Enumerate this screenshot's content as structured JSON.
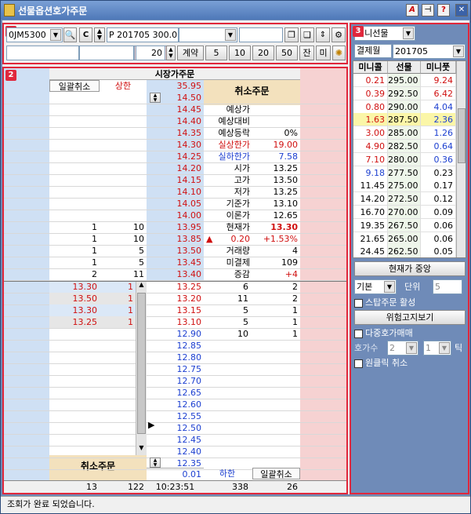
{
  "window": {
    "title": "선물옵션호가주문"
  },
  "toolbar": {
    "account": "0JM5300",
    "symbol": "P 201705 300.0",
    "qty": "20",
    "contract_label": "계약",
    "qty_presets": [
      "5",
      "10",
      "20",
      "50"
    ],
    "jan_label": "잔",
    "mi_label": "미"
  },
  "ladder": {
    "header": "시장가주문",
    "top_left_button": "일괄취소",
    "upper_limit_label": "상한",
    "upper_limit_price": "35.95",
    "sell_cancel": "취소주문",
    "buy_cancel": "취소주문",
    "bottom_lower_label": "하한",
    "bottom_lower_price": "0.01",
    "bottom_cancel_all": "일괄취소",
    "ask_rows": [
      {
        "price": "14.50",
        "qty": "",
        "cnt": ""
      },
      {
        "price": "14.45",
        "qty": "",
        "cnt": ""
      },
      {
        "price": "14.40",
        "qty": "",
        "cnt": ""
      },
      {
        "price": "14.35",
        "qty": "",
        "cnt": ""
      },
      {
        "price": "14.30",
        "qty": "",
        "cnt": ""
      },
      {
        "price": "14.25",
        "qty": "",
        "cnt": ""
      },
      {
        "price": "14.20",
        "qty": "",
        "cnt": ""
      },
      {
        "price": "14.15",
        "qty": "",
        "cnt": ""
      },
      {
        "price": "14.10",
        "qty": "",
        "cnt": ""
      },
      {
        "price": "14.05",
        "qty": "",
        "cnt": ""
      },
      {
        "price": "14.00",
        "qty": "",
        "cnt": ""
      },
      {
        "price": "13.95",
        "qty": "1",
        "cnt": "10"
      },
      {
        "price": "13.85",
        "qty": "1",
        "cnt": "10"
      },
      {
        "price": "13.50",
        "qty": "1",
        "cnt": "5"
      },
      {
        "price": "13.45",
        "qty": "1",
        "cnt": "5"
      },
      {
        "price": "13.40",
        "qty": "2",
        "cnt": "11"
      }
    ],
    "bid_rows": [
      {
        "price": "13.25",
        "qty": "6",
        "cnt": "2"
      },
      {
        "price": "13.20",
        "qty": "11",
        "cnt": "2"
      },
      {
        "price": "13.15",
        "qty": "5",
        "cnt": "1"
      },
      {
        "price": "13.10",
        "qty": "5",
        "cnt": "1"
      },
      {
        "price": "12.90",
        "qty": "10",
        "cnt": "1"
      },
      {
        "price": "12.85",
        "qty": "",
        "cnt": ""
      },
      {
        "price": "12.80",
        "qty": "",
        "cnt": ""
      },
      {
        "price": "12.75",
        "qty": "",
        "cnt": ""
      },
      {
        "price": "12.70",
        "qty": "",
        "cnt": ""
      },
      {
        "price": "12.65",
        "qty": "",
        "cnt": ""
      },
      {
        "price": "12.60",
        "qty": "",
        "cnt": ""
      },
      {
        "price": "12.55",
        "qty": "",
        "cnt": ""
      },
      {
        "price": "12.50",
        "qty": "",
        "cnt": ""
      },
      {
        "price": "12.45",
        "qty": "",
        "cnt": ""
      },
      {
        "price": "12.40",
        "qty": "",
        "cnt": ""
      },
      {
        "price": "12.35",
        "qty": "",
        "cnt": ""
      }
    ],
    "pending_orders": [
      {
        "price": "13.30",
        "qty": "1"
      },
      {
        "price": "13.50",
        "qty": "1"
      },
      {
        "price": "13.30",
        "qty": "1"
      },
      {
        "price": "13.25",
        "qty": "1"
      }
    ],
    "info": [
      {
        "label": "예상가",
        "value": ""
      },
      {
        "label": "예상대비",
        "value": ""
      },
      {
        "label": "예상등락",
        "value": "0%"
      },
      {
        "label": "실상한가",
        "value": "19.00"
      },
      {
        "label": "실하한가",
        "value": "7.58"
      },
      {
        "label": "시가",
        "value": "13.25"
      },
      {
        "label": "고가",
        "value": "13.50"
      },
      {
        "label": "저가",
        "value": "13.25"
      },
      {
        "label": "기준가",
        "value": "13.10"
      },
      {
        "label": "이론가",
        "value": "12.65"
      },
      {
        "label": "현재가",
        "value": "13.30"
      }
    ],
    "change_arrow": "▲",
    "change_value": "0.20",
    "change_pct": "+1.53%",
    "volume_label": "거래량",
    "volume": "4",
    "open_interest_label": "미결제",
    "open_interest": "109",
    "oi_change_label": "증감",
    "oi_change": "+4",
    "footer": {
      "ask_total_qty": "13",
      "ask_total_cnt": "122",
      "time": "10:23:51",
      "bid_total_qty": "338",
      "bid_total_cnt": "26"
    }
  },
  "right": {
    "type_select": "미니선물",
    "expiry_label": "결제월",
    "expiry": "201705",
    "headers": [
      "미니콜",
      "선물",
      "미니풋"
    ],
    "rows": [
      [
        "0.21",
        "295.00",
        "9.24"
      ],
      [
        "0.39",
        "292.50",
        "6.42"
      ],
      [
        "0.80",
        "290.00",
        "4.04"
      ],
      [
        "1.63",
        "287.50",
        "2.36"
      ],
      [
        "3.00",
        "285.00",
        "1.26"
      ],
      [
        "4.90",
        "282.50",
        "0.64"
      ],
      [
        "7.10",
        "280.00",
        "0.36"
      ],
      [
        "9.18",
        "277.50",
        "0.23"
      ],
      [
        "11.45",
        "275.00",
        "0.17"
      ],
      [
        "14.20",
        "272.50",
        "0.12"
      ],
      [
        "16.70",
        "270.00",
        "0.09"
      ],
      [
        "19.35",
        "267.50",
        "0.06"
      ],
      [
        "21.65",
        "265.00",
        "0.06"
      ],
      [
        "24.45",
        "262.50",
        "0.05"
      ]
    ],
    "center_button": "현재가 중앙",
    "base_select": "기본",
    "unit_label": "단위",
    "unit_value": "5",
    "stop_order": "스탑주문 활성",
    "risk_button": "위험고지보기",
    "multi_quote": "다중호가매매",
    "quote_count_label": "호가수",
    "quote_count": "2",
    "tick_value": "1",
    "tick_label": "틱",
    "one_click": "원클릭 취소"
  },
  "status": {
    "message": "조회가 완료 되었습니다."
  },
  "badges": [
    "1",
    "2",
    "3"
  ]
}
